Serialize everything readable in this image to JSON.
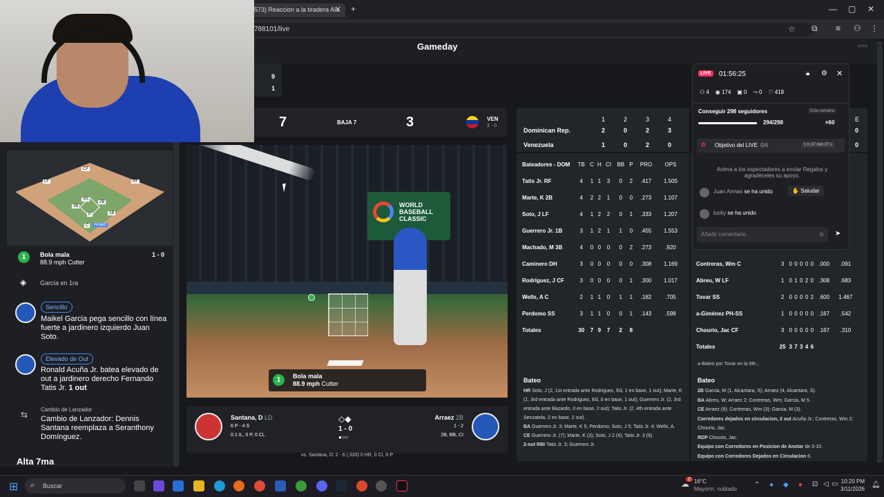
{
  "browser": {
    "tab_title": "573) Reaccion a la tiradera Ala",
    "url": "788101/live"
  },
  "header": {
    "title": "Gameday",
    "more": "○○○"
  },
  "inning_box": {
    "top": "9",
    "bottom": "1"
  },
  "score": {
    "away": "7",
    "inning": "BAJA 7",
    "home": "3",
    "team": "VEN",
    "record": "3 - 0"
  },
  "linescore": {
    "innings": [
      "1",
      "2",
      "3",
      "4"
    ],
    "rows": [
      {
        "team": "Dominican Rep.",
        "vals": [
          "2",
          "0",
          "2",
          "3"
        ]
      },
      {
        "team": "Venezuela",
        "vals": [
          "1",
          "0",
          "2",
          "0"
        ]
      }
    ],
    "extra_header": "E",
    "extra_vals": [
      "0",
      "0"
    ]
  },
  "batting_dom": {
    "title": "Bateadores - DOM",
    "cols": [
      "TB",
      "C",
      "H",
      "CI",
      "BB",
      "P",
      "PRO",
      "OPS"
    ],
    "rows": [
      {
        "n": "Tatis Jr.",
        "p": "RF",
        "v": [
          "4",
          "1",
          "1",
          "3",
          "0",
          "2",
          ".417",
          "1.505"
        ]
      },
      {
        "n": "Marte, K",
        "p": "2B",
        "v": [
          "4",
          "2",
          "2",
          "1",
          "0",
          "0",
          ".273",
          "1.107"
        ]
      },
      {
        "n": "Soto, J",
        "p": "LF",
        "v": [
          "4",
          "1",
          "2",
          "2",
          "0",
          "1",
          ".333",
          "1.207"
        ]
      },
      {
        "n": "Guerrero Jr.",
        "p": "1B",
        "v": [
          "3",
          "1",
          "2",
          "1",
          "1",
          "0",
          ".455",
          "1.553"
        ]
      },
      {
        "n": "Machado, M",
        "p": "3B",
        "v": [
          "4",
          "0",
          "0",
          "0",
          "0",
          "2",
          ".273",
          ".920"
        ]
      },
      {
        "n": "Caminero",
        "p": "DH",
        "v": [
          "3",
          "0",
          "0",
          "0",
          "0",
          "0",
          ".308",
          "1.169"
        ]
      },
      {
        "n": "Rodríguez, J",
        "p": "CF",
        "v": [
          "3",
          "0",
          "0",
          "0",
          "0",
          "1",
          ".300",
          "1.017"
        ]
      },
      {
        "n": "Wells, A",
        "p": "C",
        "v": [
          "2",
          "1",
          "1",
          "0",
          "1",
          "1",
          ".182",
          ".705"
        ]
      },
      {
        "n": "Perdomo",
        "p": "SS",
        "v": [
          "3",
          "1",
          "1",
          "0",
          "0",
          "1",
          ".143",
          ".598"
        ]
      }
    ],
    "totals": {
      "n": "Totales",
      "v": [
        "30",
        "7",
        "9",
        "7",
        "2",
        "8"
      ]
    }
  },
  "batting_ven": {
    "rows": [
      {
        "n": "Contreras, Wm",
        "p": "C",
        "v": [
          "3",
          "0",
          "0",
          "0",
          "0",
          "0",
          ".000",
          ".091"
        ]
      },
      {
        "n": "Abreu, W",
        "p": "LF",
        "v": [
          "1",
          "0",
          "1",
          "0",
          "2",
          "0",
          ".308",
          ".683"
        ]
      },
      {
        "n": "Tovar",
        "p": "SS",
        "v": [
          "2",
          "0",
          "0",
          "0",
          "0",
          "2",
          ".600",
          "1.467"
        ]
      },
      {
        "n": "a-Giménez",
        "p": "PH-SS",
        "v": [
          "1",
          "0",
          "0",
          "0",
          "0",
          "0",
          ".167",
          ".542"
        ]
      },
      {
        "n": "Chourio, Jac",
        "p": "CF",
        "v": [
          "3",
          "0",
          "0",
          "0",
          "0",
          "0",
          ".167",
          ".310"
        ]
      }
    ],
    "totals": {
      "n": "Totales",
      "v": [
        "25",
        "3",
        "7",
        "3",
        "4",
        "6"
      ]
    },
    "note": "a-Bateó por Tovar en la 6th.;"
  },
  "batting_notes_dom": {
    "title": "Bateo",
    "lines": [
      {
        "k": "HR",
        "t": "Soto, J (2, 1st entrada ante Rodriguez, Ed, 1 en base, 1 out); Marte, K (1, 3rd entrada ante Rodriguez, Ed, 0 en base, 1 out); Guerrero Jr. (2, 3rd entrada ante Bazardo, 0 en base, 2 out); Tatis Jr. (2, 4th entrada ante Senzatela, 2 en base, 2 out)."
      },
      {
        "k": "BA",
        "t": "Guerrero Jr. 3; Marte, K 5; Perdomo; Soto, J 5; Tatis Jr. 4; Wells, A."
      },
      {
        "k": "CE",
        "t": "Guerrero Jr. (7); Marte, K (3); Soto, J 2 (4); Tatis Jr. 3 (9)."
      },
      {
        "k": "2-out RBI",
        "t": "Tatis Jr. 3; Guerrero Jr."
      }
    ]
  },
  "batting_notes_ven": {
    "title": "Bateo",
    "lines": [
      {
        "k": "2B",
        "t": "Garcia, M (1, Alcantara, S); Arraez (4, Alcantara, S)."
      },
      {
        "k": "BA",
        "t": "Abreu, W; Arraez 2; Contreras, Wm; Garcia, M 5."
      },
      {
        "k": "CE",
        "t": "Arraez (8); Contreras, Wm (3); Garcia, M (3)."
      },
      {
        "k": "Corredores dejados en circulacion, 2 out",
        "t": "Acuña Jr.; Contreras, Wm 2; Chourio, Jac."
      },
      {
        "k": "RDP",
        "t": "Chourio, Jac."
      },
      {
        "k": "Equipo con Corredores en Posicion de Anotar",
        "t": "de 3-10."
      },
      {
        "k": "Equipo con Corredores Dejados en Circulacion",
        "t": "6."
      }
    ]
  },
  "field_labels": {
    "lf": "LF",
    "cf": "CF",
    "rf": "RF",
    "ss": "SS",
    "b2": "2B",
    "b3": "3B",
    "b1": "1B",
    "p": "P",
    "c": "C",
    "batter": "Arraez"
  },
  "pitch": {
    "num": "1",
    "result": "Bola mala",
    "speed": "88.9 mph",
    "type": "Cutter",
    "count": "1 - 0"
  },
  "play_feed": [
    {
      "kind": "pitch",
      "num": "1",
      "title": "Bola mala",
      "sub": "88.9 mph Cutter",
      "count": "1 - 0"
    },
    {
      "kind": "event",
      "title": "García en 1ra"
    },
    {
      "kind": "play",
      "tag": "Sencillo",
      "text": "Maikel Garcia pega sencillo con línea fuerte a jardinero izquierdo Juan Soto."
    },
    {
      "kind": "play",
      "tag": "Elevado de Out",
      "text": "Ronald Acuña Jr. batea elevado de out a jardinero derecho Fernando Tatis Jr.",
      "strong": "1 out"
    },
    {
      "kind": "change",
      "tag": "Cambio de Lanzador",
      "text": "Cambio de Lanzador: Dennis Santana reemplaza a Seranthony Domínguez."
    }
  ],
  "feed_section": "Alta 7ma",
  "matchup": {
    "pitcher": "Santana, D",
    "pitcher_pos": "LD",
    "pitcher_line1": "6 P - 4 S",
    "pitcher_line2": "0.1 IL, 0 P, 0 CL",
    "count": "1 - 0",
    "outs": "●○○",
    "batter": "Arraez",
    "batter_pos": "2B",
    "batter_line1": "1 - 2",
    "batter_line2": "2B, BB, CI",
    "vs": "vs. Santana, D: 2 - 6 (.333) 0 HR, 0 CI, 0 P"
  },
  "live": {
    "badge": "LIVE",
    "time": "01:56:25",
    "stats": [
      {
        "icon": "users-icon",
        "v": "4"
      },
      {
        "icon": "eye-icon",
        "v": "174"
      },
      {
        "icon": "gift-icon",
        "v": "0"
      },
      {
        "icon": "share-icon",
        "v": "0"
      },
      {
        "icon": "heart-icon",
        "v": "418"
      }
    ],
    "goal_title": "Conseguir 298 seguidores",
    "goal_week": "Esta semana",
    "goal_progress": "294/298",
    "goal_bonus": "×60",
    "goal_fraction": 0.987,
    "objective": "Objetivo del LIVE",
    "objective_count": "0/4",
    "objective_time": "1 h 37 min 27 s",
    "hint": "Anima a los espectadores a enviar Regalos y agradéceles su apoyo.",
    "joins": [
      {
        "user": "Juan Armas",
        "action": "se ha unido",
        "btn": "Saludar"
      },
      {
        "user": "lucky",
        "action": "se ha unido"
      }
    ],
    "comment_placeholder": "Añadir comentario"
  },
  "taskbar": {
    "search": "Buscar",
    "weather_temp": "16°C",
    "weather_desc": "Mayorm. nublado",
    "time": "10:20 PM",
    "date": "3/11/2026",
    "badge": "2"
  },
  "colors": {
    "live": "#fe2c55",
    "accent": "#4a86ff",
    "green": "#2bb24c"
  }
}
